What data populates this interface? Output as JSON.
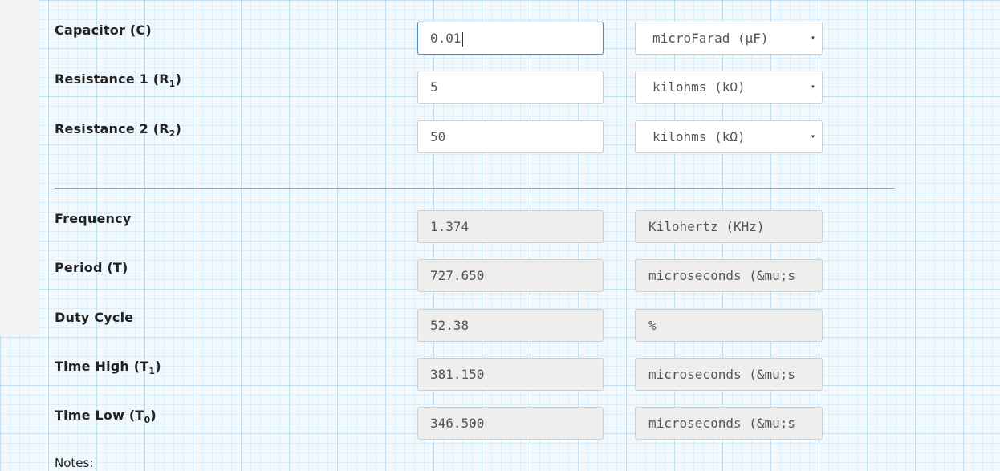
{
  "inputs": [
    {
      "label": "Capacitor (C)",
      "value": "0.01",
      "unit": "microFarad (μF)"
    },
    {
      "label_main": "Resistance 1 (R",
      "label_sub": "1",
      "label_end": ")",
      "value": "5",
      "unit": "kilohms (kΩ)"
    },
    {
      "label_main": "Resistance 2 (R",
      "label_sub": "2",
      "label_end": ")",
      "value": "50",
      "unit": "kilohms (kΩ)"
    }
  ],
  "outputs": [
    {
      "label": "Frequency",
      "value": "1.374",
      "unit": "Kilohertz (KHz)"
    },
    {
      "label": "Period (T)",
      "value": "727.650",
      "unit": "microseconds (&mu;s"
    },
    {
      "label": "Duty Cycle",
      "value": "52.38",
      "unit": "%"
    },
    {
      "label_main": "Time High (T",
      "label_sub": "1",
      "label_end": ")",
      "value": "381.150",
      "unit": "microseconds (&mu;s"
    },
    {
      "label_main": "Time Low (T",
      "label_sub": "0",
      "label_end": ")",
      "value": "346.500",
      "unit": "microseconds (&mu;s"
    }
  ],
  "notes_label": "Notes:",
  "icons": {
    "select_caret": "▾"
  }
}
